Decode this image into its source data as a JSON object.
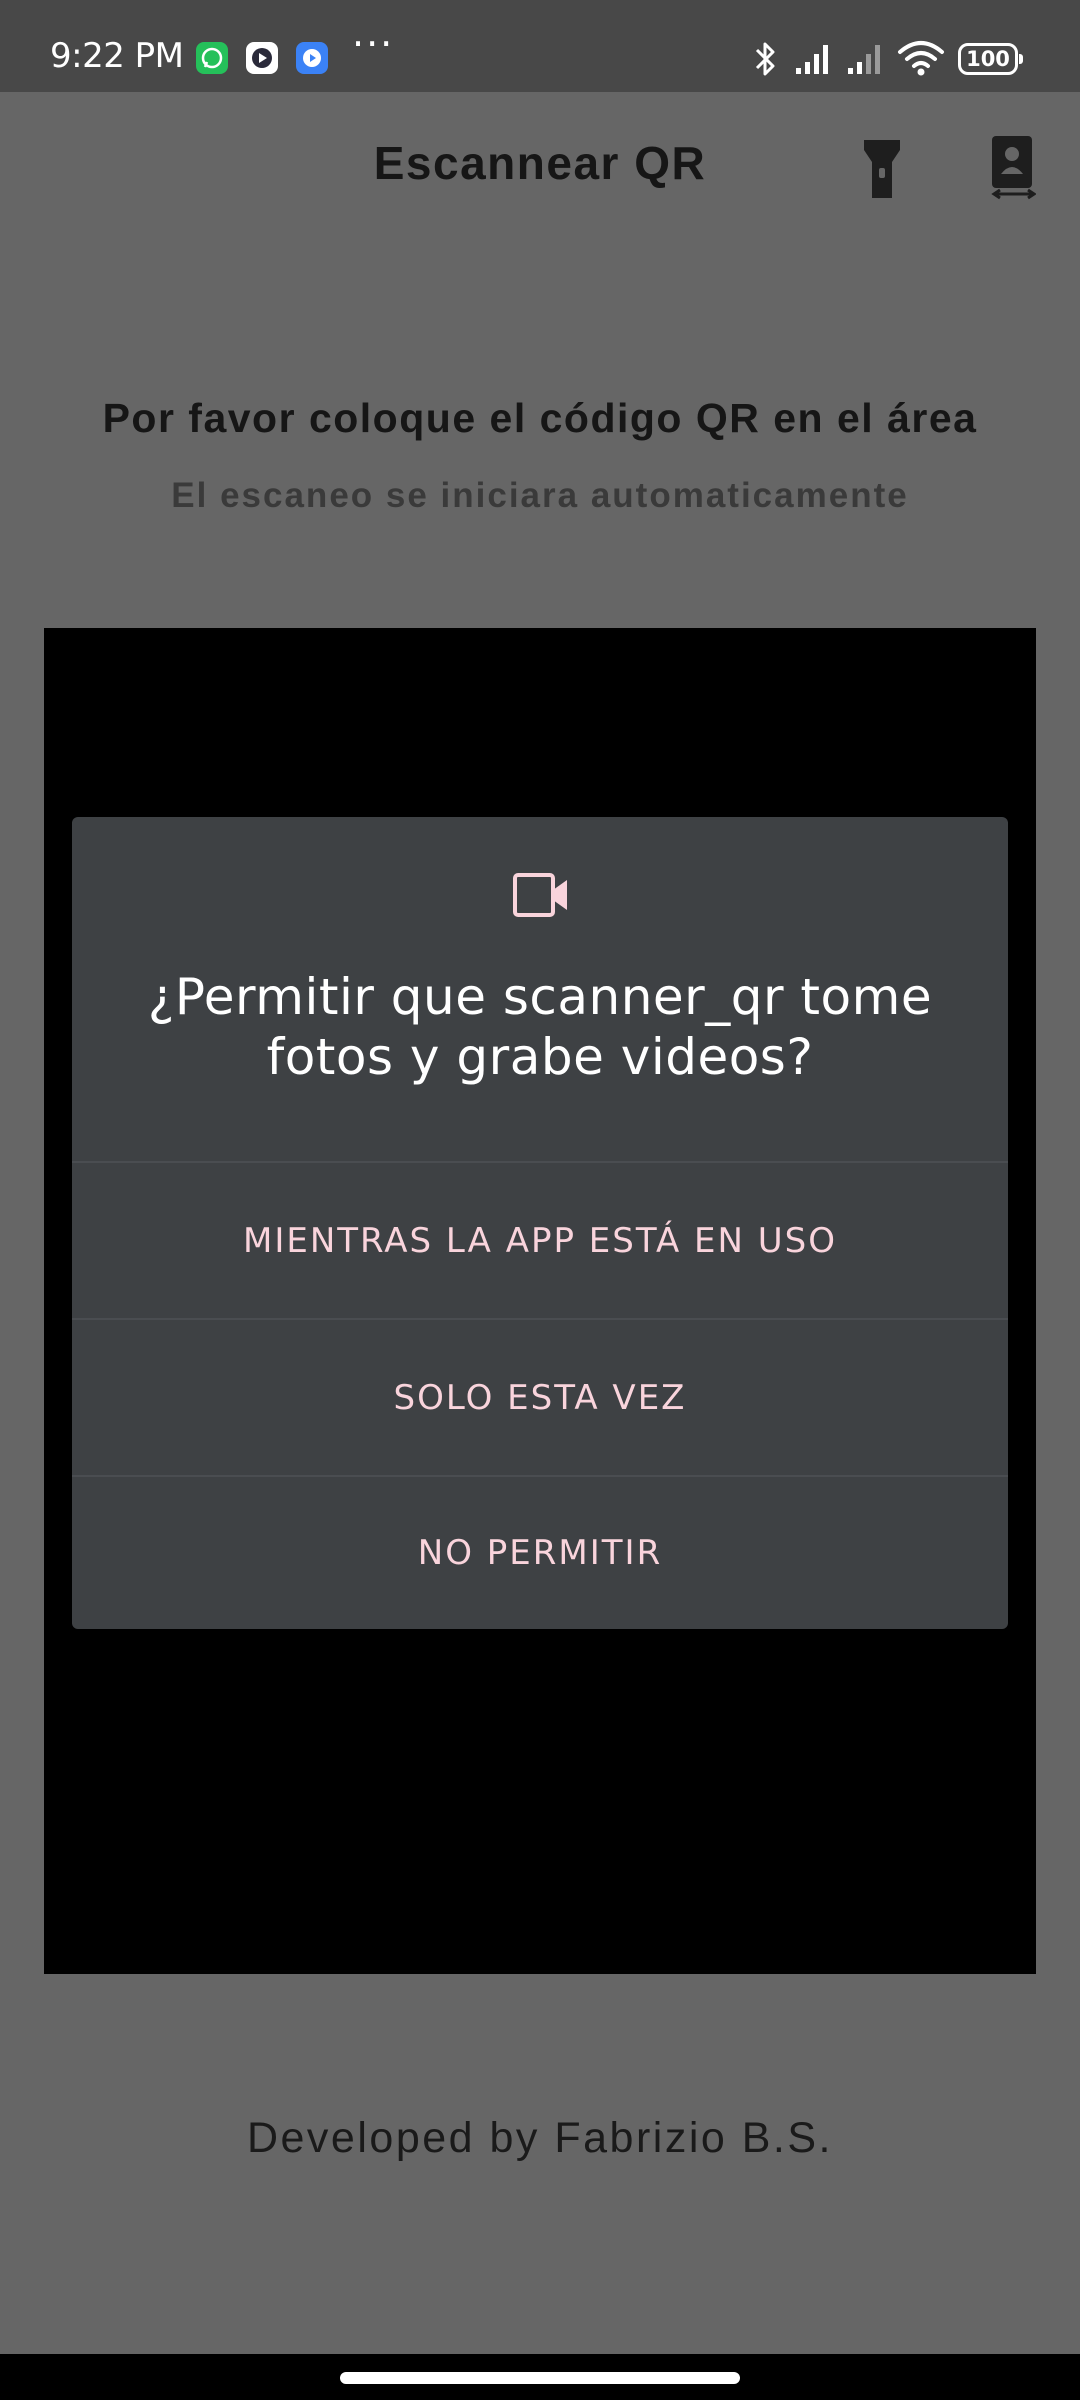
{
  "status_bar": {
    "time": "9:22 PM",
    "overflow_indicator": "···",
    "battery_level": "100",
    "icons": [
      "whatsapp-icon",
      "media-app-icon",
      "video-app-icon",
      "bluetooth-icon",
      "signal-icon",
      "signal-icon",
      "wifi-icon",
      "battery-icon"
    ]
  },
  "app_bar": {
    "title": "Escannear QR",
    "icons": [
      "flashlight-icon",
      "switch-camera-icon"
    ]
  },
  "instructions": {
    "title": "Por favor coloque el código QR en el área",
    "subtitle": "El escaneo se iniciara automaticamente"
  },
  "permission_dialog": {
    "icon": "videocam-icon",
    "title": "¿Permitir que scanner_qr tome fotos y grabe videos?",
    "options": [
      {
        "label": "MIENTRAS LA APP ESTÁ EN USO"
      },
      {
        "label": "SOLO ESTA VEZ"
      },
      {
        "label": "NO PERMITIR"
      }
    ],
    "accent_color": "#f9d4dc"
  },
  "footer": {
    "credit": "Developed by Fabrizio B.S."
  },
  "colors": {
    "background": "#666666",
    "status_bar": "#484848",
    "camera_preview": "#000000",
    "dialog_background": "#3e4144"
  }
}
